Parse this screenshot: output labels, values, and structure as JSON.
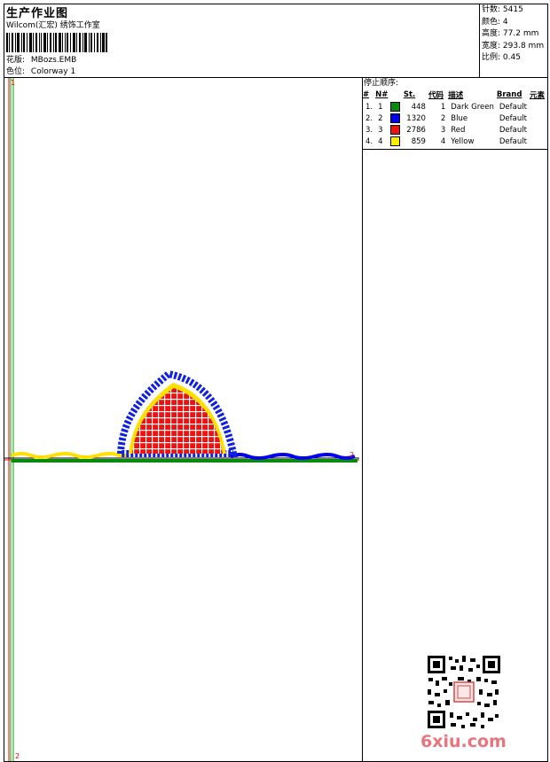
{
  "header": {
    "title": "生产作业图",
    "company": "Wilcom(汇宏) 绣饰工作室",
    "design_label": "花版:",
    "design_name": "MBozs.EMB",
    "colorway_label": "色位:",
    "colorway_name": "Colorway 1"
  },
  "stats": {
    "stitches_label": "针数:",
    "stitches_value": "5415",
    "colors_label": "颜色:",
    "colors_value": "4",
    "height_label": "高度:",
    "height_value": "77.2 mm",
    "width_label": "宽度:",
    "width_value": "293.8 mm",
    "scale_label": "比例:",
    "scale_value": "0.45"
  },
  "stop_sequence": {
    "title": "停止顺序:",
    "columns": [
      "#",
      "N#",
      "St.",
      "代码",
      "描述",
      "Brand",
      "元素"
    ],
    "rows": [
      {
        "idx": "1.",
        "n": "1",
        "st": "448",
        "code": "1",
        "desc": "Dark Green",
        "brand": "Default",
        "color": "#0a8a0a"
      },
      {
        "idx": "2.",
        "n": "2",
        "st": "1320",
        "code": "2",
        "desc": "Blue",
        "brand": "Default",
        "color": "#0000ee"
      },
      {
        "idx": "3.",
        "n": "3",
        "st": "2786",
        "code": "3",
        "desc": "Red",
        "brand": "Default",
        "color": "#ee1111"
      },
      {
        "idx": "4.",
        "n": "4",
        "st": "859",
        "code": "4",
        "desc": "Yellow",
        "brand": "Default",
        "color": "#ffee00"
      }
    ]
  },
  "canvas": {
    "marker_top": "1",
    "marker_bottom": "2",
    "marker_right": "2"
  },
  "watermark": "6xiu.com"
}
